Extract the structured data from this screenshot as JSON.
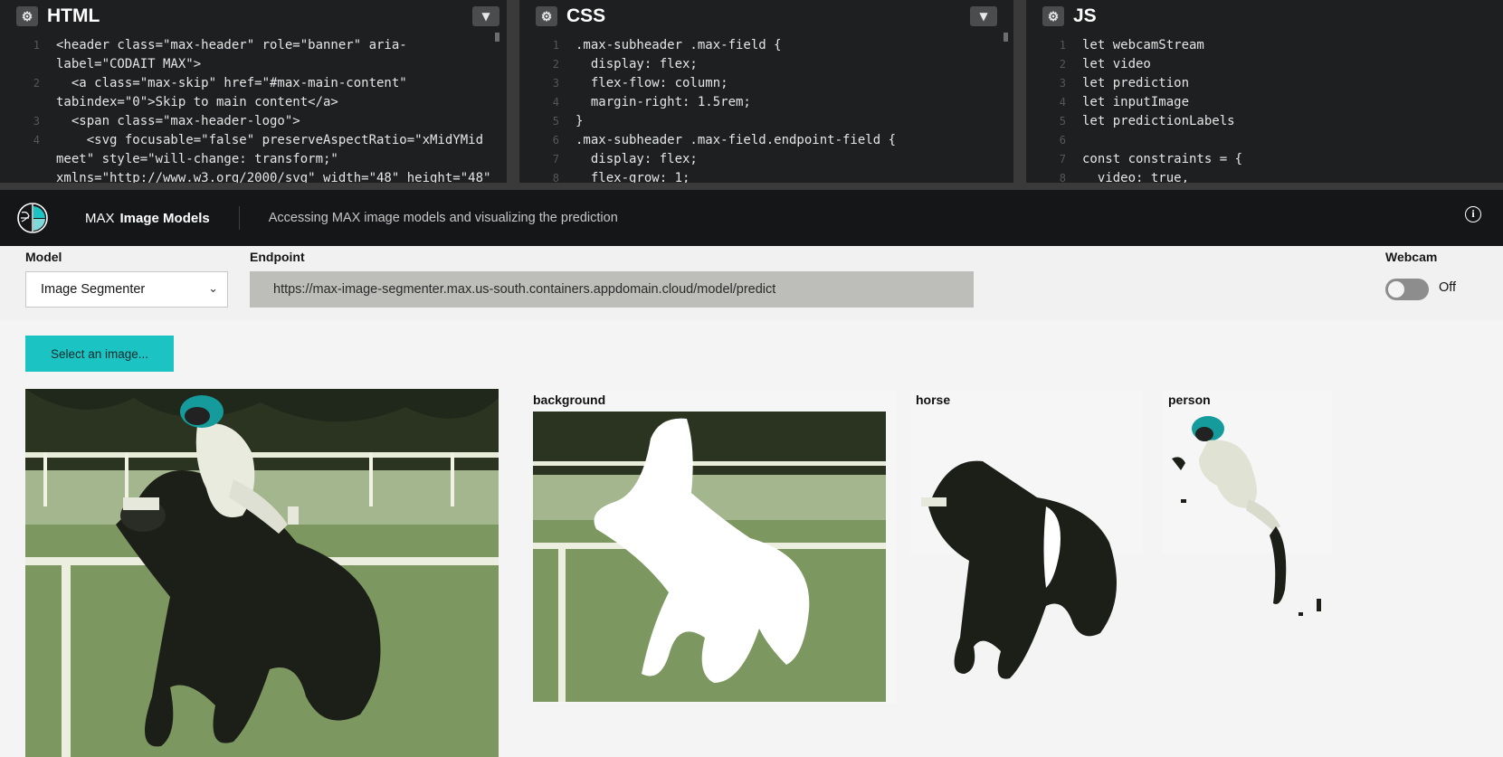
{
  "editors": {
    "html": {
      "title": "HTML",
      "lines": [
        {
          "n": "1",
          "text": "<header class=\"max-header\" role=\"banner\" aria-"
        },
        {
          "n": "",
          "text": "label=\"CODAIT MAX\">"
        },
        {
          "n": "2",
          "text": "  <a class=\"max-skip\" href=\"#max-main-content\""
        },
        {
          "n": "",
          "text": "tabindex=\"0\">Skip to main content</a>"
        },
        {
          "n": "3",
          "text": "  <span class=\"max-header-logo\">"
        },
        {
          "n": "4",
          "text": "    <svg focusable=\"false\" preserveAspectRatio=\"xMidYMid"
        },
        {
          "n": "",
          "text": "meet\" style=\"will-change: transform;\""
        },
        {
          "n": "",
          "text": "xmlns=\"http://www.w3.org/2000/svg\" width=\"48\" height=\"48\""
        }
      ]
    },
    "css": {
      "title": "CSS",
      "lines": [
        {
          "n": "1",
          "text": ".max-subheader .max-field {"
        },
        {
          "n": "2",
          "text": "  display: flex;"
        },
        {
          "n": "3",
          "text": "  flex-flow: column;"
        },
        {
          "n": "4",
          "text": "  margin-right: 1.5rem;"
        },
        {
          "n": "5",
          "text": "}"
        },
        {
          "n": "6",
          "text": ".max-subheader .max-field.endpoint-field {"
        },
        {
          "n": "7",
          "text": "  display: flex;"
        },
        {
          "n": "8",
          "text": "  flex-grow: 1;"
        }
      ]
    },
    "js": {
      "title": "JS",
      "lines": [
        {
          "n": "1",
          "text": "let webcamStream"
        },
        {
          "n": "2",
          "text": "let video"
        },
        {
          "n": "3",
          "text": "let prediction"
        },
        {
          "n": "4",
          "text": "let inputImage"
        },
        {
          "n": "5",
          "text": "let predictionLabels"
        },
        {
          "n": "6",
          "text": ""
        },
        {
          "n": "7",
          "text": "const constraints = {"
        },
        {
          "n": "8",
          "text": "  video: true,"
        }
      ]
    }
  },
  "header": {
    "brand_prefix": "MAX",
    "brand_name": "Image Models",
    "tagline": "Accessing MAX image models and visualizing the prediction",
    "info_icon": "info-icon"
  },
  "controls": {
    "model_label": "Model",
    "model_value": "Image Segmenter",
    "endpoint_label": "Endpoint",
    "endpoint_value": "https://max-image-segmenter.max.us-south.containers.appdomain.cloud/model/predict",
    "webcam_label": "Webcam",
    "webcam_state": "Off"
  },
  "main": {
    "select_button": "Select an image...",
    "segments": [
      {
        "label": "background"
      },
      {
        "label": "horse"
      },
      {
        "label": "person"
      }
    ]
  },
  "colors": {
    "accent": "#1cc3c3",
    "header_bg": "#151617",
    "editor_bg": "#1d1f20"
  }
}
